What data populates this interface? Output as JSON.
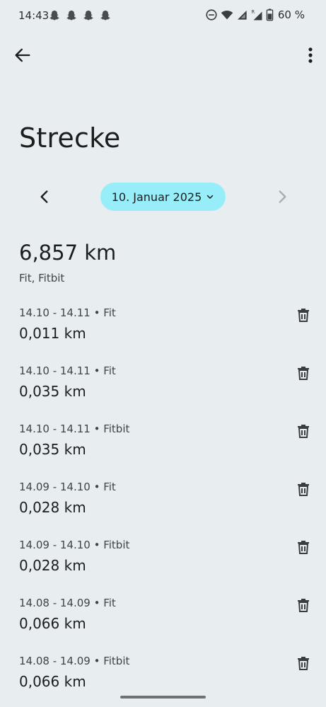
{
  "status_bar": {
    "time": "14:43",
    "battery": "60 %"
  },
  "header": {
    "title": "Strecke"
  },
  "date_nav": {
    "date": "10. Januar 2025"
  },
  "summary": {
    "total": "6,857 km",
    "sources": "Fit, Fitbit"
  },
  "entries": [
    {
      "meta": "14.10 - 14.11 • Fit",
      "value": "0,011 km"
    },
    {
      "meta": "14.10 - 14.11 • Fit",
      "value": "0,035 km"
    },
    {
      "meta": "14.10 - 14.11 • Fitbit",
      "value": "0,035 km"
    },
    {
      "meta": "14.09 - 14.10 • Fit",
      "value": "0,028 km"
    },
    {
      "meta": "14.09 - 14.10 • Fitbit",
      "value": "0,028 km"
    },
    {
      "meta": "14.08 - 14.09 • Fit",
      "value": "0,066 km"
    },
    {
      "meta": "14.08 - 14.09 • Fitbit",
      "value": "0,066 km"
    }
  ],
  "colors": {
    "background": "#e8edf0",
    "date_chip": "#97eef8",
    "text_primary": "#1b1d1f",
    "text_secondary": "#3f4447",
    "disabled": "#a9adb0"
  },
  "icons": {
    "notifications": [
      "snapchat-icon",
      "snapchat-icon",
      "snapchat-icon",
      "snapchat-icon"
    ],
    "status": [
      "do-not-disturb-icon",
      "wifi-icon",
      "signal-icon",
      "signal-roaming-icon",
      "battery-icon"
    ],
    "back": "arrow-back-icon",
    "more": "more-vert-icon",
    "prev": "chevron-left-icon",
    "next": "chevron-right-icon",
    "date_dropdown": "chevron-down-icon",
    "delete": "trash-icon"
  }
}
